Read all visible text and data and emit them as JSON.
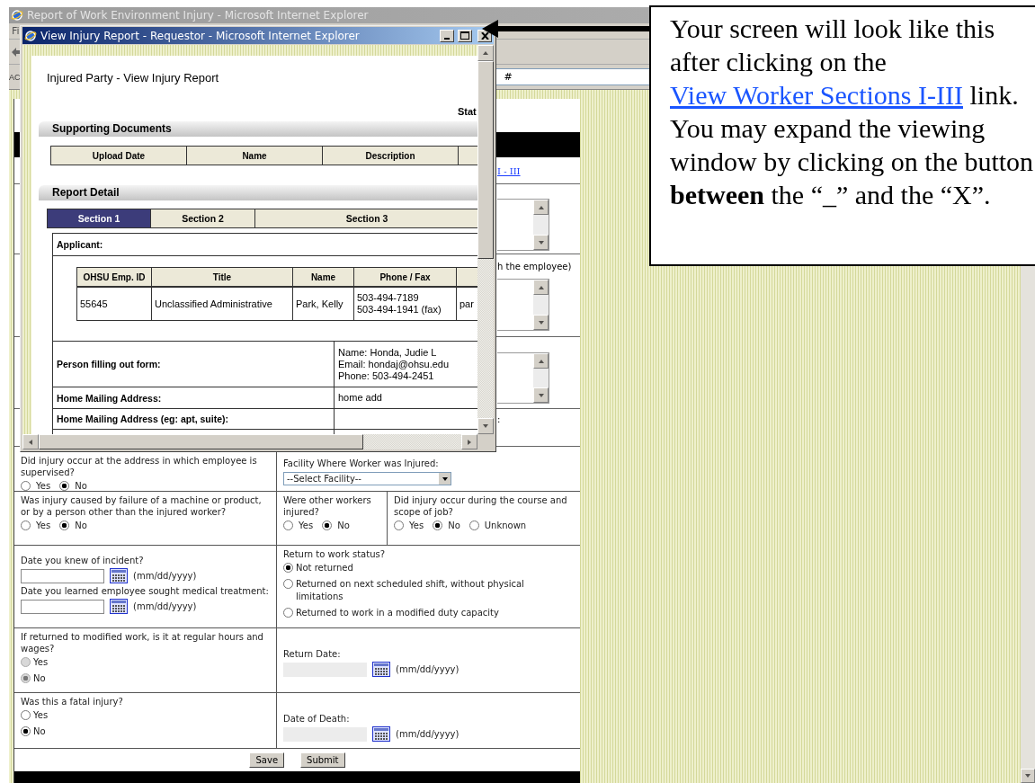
{
  "background_window": {
    "title": "Report of Work Environment Injury - Microsoft Internet Explorer",
    "menu_fragment": "Fi",
    "address_label_fragment": "AC",
    "address_fragment": "#",
    "link_fragment": "I - III",
    "note_fragment": "h the employee)",
    "label_fragment": ":"
  },
  "popup": {
    "title": "View Injury Report - Requestor - Microsoft Internet Explorer",
    "heading": "Injured Party - View Injury Report",
    "status_fragment": "Stat",
    "supporting_documents": {
      "title": "Supporting Documents",
      "columns": [
        "Upload Date",
        "Name",
        "Description"
      ]
    },
    "report_detail": {
      "title": "Report Detail",
      "tabs": [
        {
          "label": "Section 1",
          "selected": true
        },
        {
          "label": "Section 2",
          "selected": false
        },
        {
          "label": "Section 3",
          "selected": false
        }
      ],
      "applicant_label": "Applicant:",
      "applicant_columns": [
        "OHSU Emp. ID",
        "Title",
        "Name",
        "Phone / Fax"
      ],
      "applicant_row": [
        "55645",
        "Unclassified Administrative",
        "Park, Kelly",
        "503-494-7189\n503-494-1941 (fax)",
        "par"
      ],
      "details": [
        {
          "label": "Person filling out form:",
          "value": "Name: Honda, Judie L\nEmail: hondaj@ohsu.edu\nPhone: 503-494-2451"
        },
        {
          "label": "Home Mailing Address:",
          "value": "home add"
        },
        {
          "label": "Home Mailing Address (eg: apt, suite):"
        }
      ]
    }
  },
  "form": {
    "rows": [
      {
        "cells": [
          {
            "kind": "radio_inline",
            "question": "Did injury occur at the address in which employee is supervised?",
            "options": [
              {
                "label": "Yes",
                "selected": false
              },
              {
                "label": "No",
                "selected": true
              }
            ]
          },
          {
            "kind": "select",
            "label": "Facility Where Worker was Injured:",
            "value": "--Select Facility--"
          }
        ]
      },
      {
        "cells": [
          {
            "kind": "radio_inline",
            "question": "Was injury caused by failure of a machine or product, or by a person other than the injured worker?",
            "options": [
              {
                "label": "Yes",
                "selected": false
              },
              {
                "label": "No",
                "selected": true
              }
            ]
          },
          {
            "kind": "radio_inline",
            "question": "Were other workers injured?",
            "options": [
              {
                "label": "Yes",
                "selected": false
              },
              {
                "label": "No",
                "selected": true
              }
            ]
          },
          {
            "kind": "radio_inline",
            "question": "Did injury occur during the course and scope of job?",
            "options": [
              {
                "label": "Yes",
                "selected": false
              },
              {
                "label": "No",
                "selected": true
              },
              {
                "label": "Unknown",
                "selected": false
              }
            ]
          }
        ]
      },
      {
        "cells": [
          {
            "kind": "dates",
            "fields": [
              {
                "label": "Date you knew of incident?",
                "hint": "(mm/dd/yyyy)",
                "disabled": false
              },
              {
                "label": "Date you learned employee sought medical treatment:",
                "hint": "(mm/dd/yyyy)",
                "disabled": false
              }
            ]
          },
          {
            "kind": "radio_stacked",
            "question": "Return to work status?",
            "options": [
              {
                "label": "Not returned",
                "selected": true
              },
              {
                "label": "Returned on next scheduled shift, without physical limitations",
                "selected": false
              },
              {
                "label": "Returned to work in a modified duty capacity",
                "selected": false
              }
            ]
          }
        ]
      },
      {
        "cells": [
          {
            "kind": "radio_stacked",
            "question": "If returned to modified work, is it at regular hours and wages?",
            "disabled": true,
            "options": [
              {
                "label": "Yes",
                "selected": false
              },
              {
                "label": "No",
                "selected": true
              }
            ]
          },
          {
            "kind": "dates",
            "fields": [
              {
                "label": "Return Date:",
                "hint": "(mm/dd/yyyy)",
                "disabled": true
              }
            ]
          }
        ]
      },
      {
        "cells": [
          {
            "kind": "radio_stacked",
            "question": "Was this a fatal injury?",
            "options": [
              {
                "label": "Yes",
                "selected": false
              },
              {
                "label": "No",
                "selected": true
              }
            ]
          },
          {
            "kind": "dates",
            "fields": [
              {
                "label": "Date of Death:",
                "hint": "(mm/dd/yyyy)",
                "disabled": true
              }
            ]
          }
        ]
      }
    ],
    "buttons": [
      "Save",
      "Submit"
    ]
  },
  "callout": {
    "text_before": "Your screen will look like this after clicking on the",
    "link": "View Worker Sections I-III",
    "text_after": "link. You may expand the viewing window by clicking on the button **between** the “_” and the “X”."
  }
}
